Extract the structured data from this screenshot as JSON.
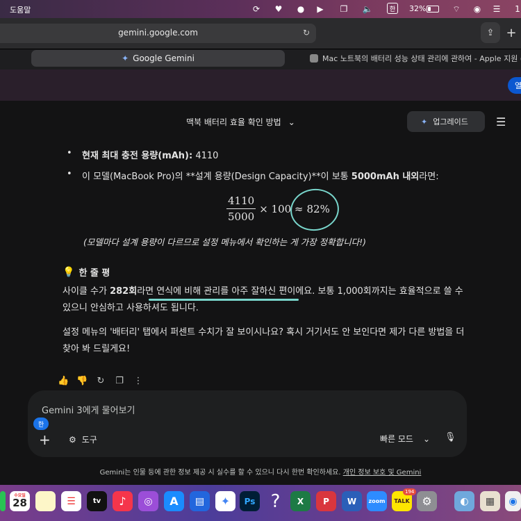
{
  "menubar": {
    "help_menu": "도움말",
    "ime_label": "한",
    "battery_text": "32%",
    "battery_level": 0.32,
    "right_edge_text": "1"
  },
  "browser": {
    "url": "gemini.google.com",
    "tabs": [
      {
        "label": "Google Gemini",
        "active": true
      },
      {
        "label": "Mac 노트북의 배터리 성능 상태 관리에 관하여 - Apple 지원 (KR)",
        "active": false
      }
    ],
    "banner_button": "열"
  },
  "header": {
    "conversation_title": "맥북 배터리 효율 확인 방법",
    "upgrade_label": "업그레이드"
  },
  "message": {
    "bullet1_bold": "현재 최대 충전 용량(mAh):",
    "bullet1_value": " 4110",
    "bullet2_pre": "이 모델(MacBook Pro)의 **설계 용량(Design Capacity)**이 보통 ",
    "bullet2_bold": "5000mAh 내외",
    "bullet2_post": "라면:",
    "math": {
      "numerator": "4110",
      "denominator": "5000",
      "times": "× 100 ≈",
      "result": "82%"
    },
    "note": "(모델마다 설계 용량이 다르므로 설정 메뉴에서 확인하는 게 가장 정확합니다!)",
    "summary_icon": "lightbulb-icon",
    "summary_title": "한 줄 평",
    "para1_pre": "사이클 수가 ",
    "para1_bold": "282회",
    "para1_post": "라면 연식에 비해 관리를 아주 잘하신 편이에요. 보통 1,000회까지는 효율적으로 쓸 수 있으니 안심하고 사용하셔도 됩니다.",
    "para2": "설정 메뉴의 '배터리' 탭에서 퍼센트 수치가 잘 보이시나요? 혹시 거기서도 안 보인다면 제가 다른 방법을 더 찾아 봐 드릴게요!"
  },
  "input": {
    "placeholder": "Gemini 3에게 물어보기",
    "ime_badge": "한",
    "tools_label": "도구",
    "mode_label": "빠른 모드"
  },
  "footer": {
    "disclaimer": "Gemini는 인물 등에 관한 정보 제공 시 실수를 할 수 있으니 다시 한번 확인하세요. ",
    "link": "개인 정보 보호 및 Gemini"
  },
  "dock": {
    "calendar_month": "수요일",
    "calendar_day": "28",
    "tv_label": "tv",
    "ps_label": "Ps",
    "zoom_label": "zoom",
    "talk_label": "TALK",
    "talk_badge": "194",
    "help_glyph": "?"
  },
  "colors": {
    "annotation": "#79d6cc",
    "background": "#131314",
    "accent_blue": "#0b57d0"
  }
}
